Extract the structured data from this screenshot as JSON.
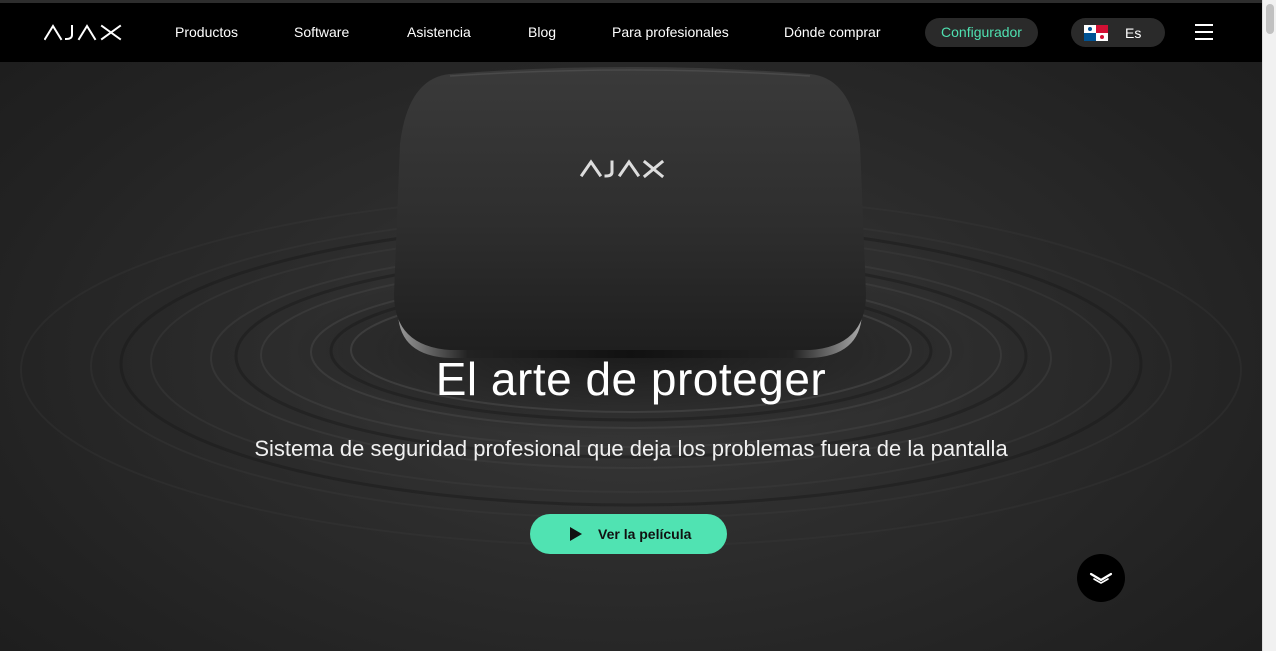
{
  "brand": {
    "name": "AJAX"
  },
  "nav": {
    "items": [
      {
        "label": "Productos"
      },
      {
        "label": "Software"
      },
      {
        "label": "Asistencia"
      },
      {
        "label": "Blog"
      },
      {
        "label": "Para profesionales"
      },
      {
        "label": "Dónde comprar"
      }
    ],
    "configurator_label": "Configurador",
    "language_label": "Es",
    "flag_icon": "panama-flag-icon",
    "menu_icon": "hamburger-menu-icon"
  },
  "hero": {
    "title": "El arte de proteger",
    "subtitle": "Sistema de seguridad profesional que deja los problemas fuera de la pantalla",
    "cta_label": "Ver la película",
    "cta_icon": "play-icon",
    "device_logo": "AJAX",
    "scroll_icon": "chevron-down-icon"
  },
  "colors": {
    "accent": "#50e3b2",
    "configurator_text": "#4fe0b0",
    "nav_background": "#000000",
    "hero_background": "#2c2c2c"
  }
}
